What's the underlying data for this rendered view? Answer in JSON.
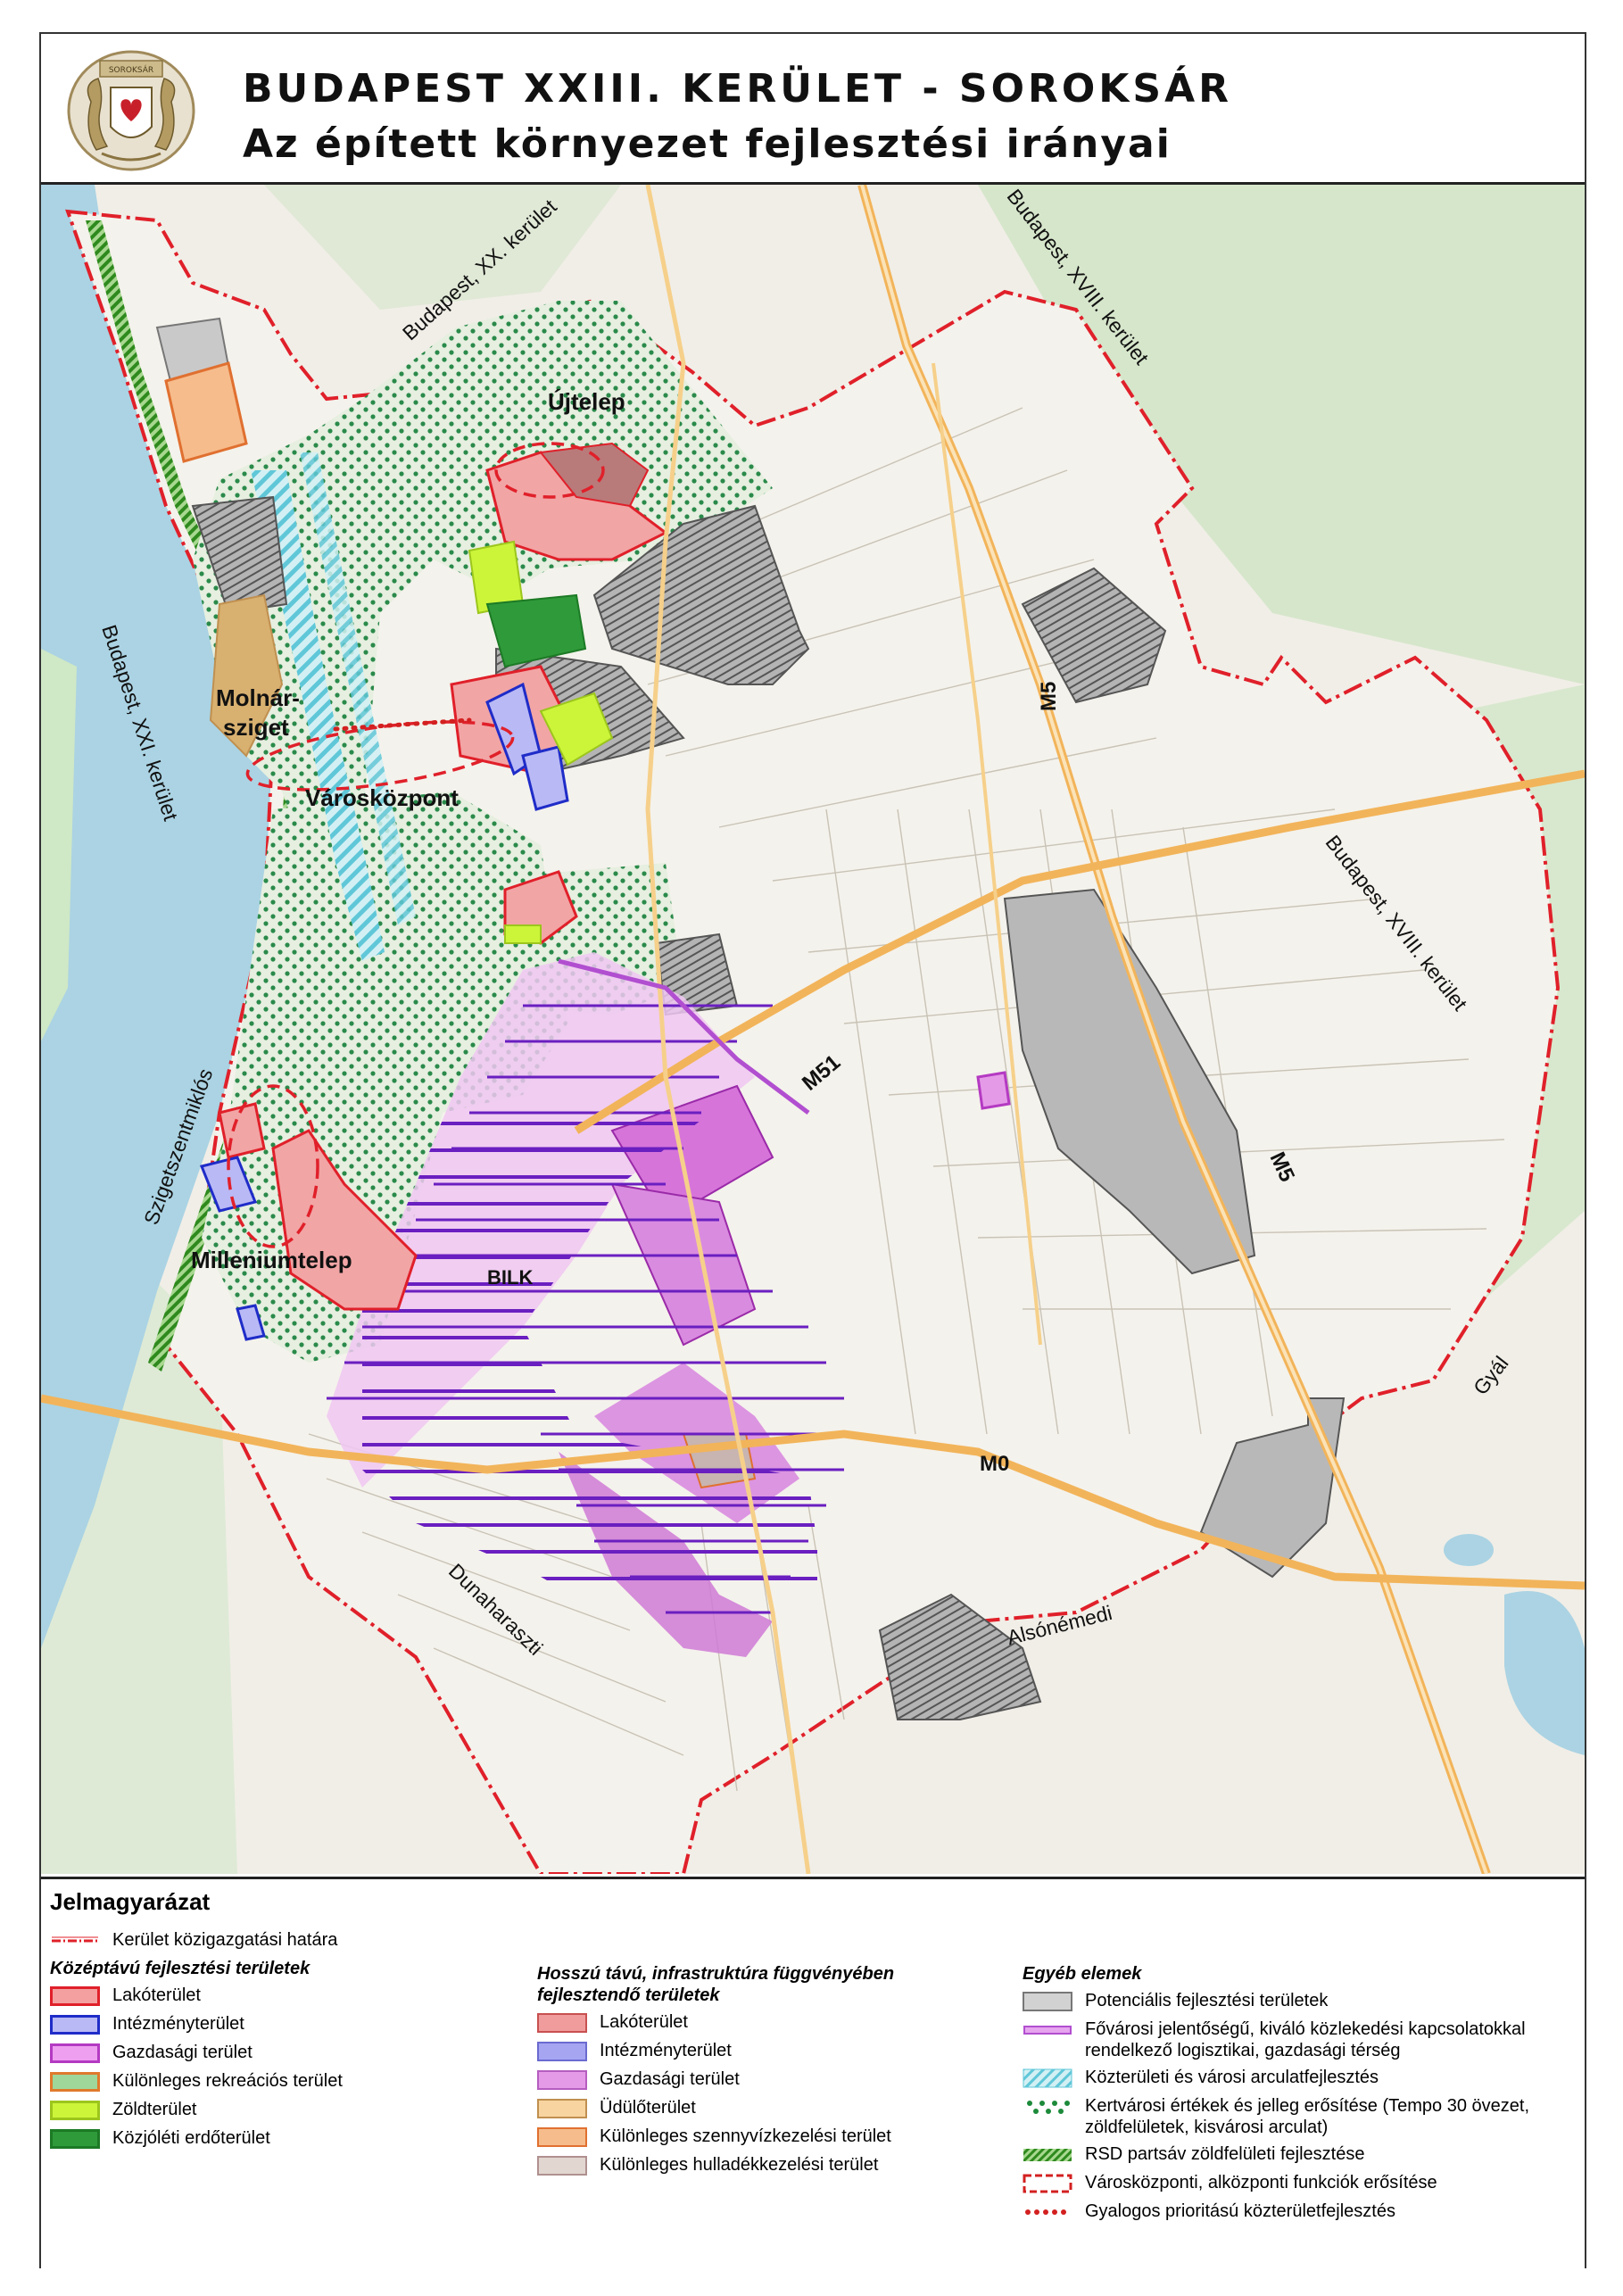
{
  "header": {
    "title_line1": "BUDAPEST XXIII. KERÜLET - SOROKSÁR",
    "title_line2": "Az épített környezet fejlesztési irányai",
    "crest_text": "SOROKSÁR"
  },
  "map": {
    "places": {
      "ujtelep": "Újtelep",
      "molnar1": "Molnár-",
      "molnar2": "sziget",
      "varoskozpont": "Városközpont",
      "milleniumtelep": "Milleniumtelep",
      "bilk": "BILK"
    },
    "neighbors": {
      "xx": "Budapest, XX. kerület",
      "xviii_top": "Budapest, XVIII. kerület",
      "xviii_right": "Budapest, XVIII. kerület",
      "xxi": "Budapest, XXI. kerület",
      "szigetszentmiklos": "Szigetszentmiklós",
      "dunaharaszti": "Dunaharaszti",
      "alsonemedi": "Alsónémedi",
      "gyal": "Gyál"
    },
    "roads": {
      "m5_top": "M5",
      "m5_bottom": "M5",
      "m51": "M51",
      "m0": "M0"
    }
  },
  "legend": {
    "title": "Jelmagyarázat",
    "boundary_label": "Kerület közigazgatási határa",
    "col1": {
      "heading": "Középtávú fejlesztési területek",
      "items": [
        {
          "label": "Lakóterület",
          "fill": "#f4a0a0",
          "border": "#e0202a"
        },
        {
          "label": "Intézményterület",
          "fill": "#b9b9f5",
          "border": "#1f2cc8"
        },
        {
          "label": "Gazdasági terület",
          "fill": "#ee9ff0",
          "border": "#b43ac2"
        },
        {
          "label": "Különleges rekreációs terület",
          "fill": "#9fd79a",
          "border": "#e07a2c"
        },
        {
          "label": "Zöldterület",
          "fill": "#ccf53a",
          "border": "#9cc61c"
        },
        {
          "label": "Közjóléti erdőterület",
          "fill": "#2f9a3a",
          "border": "#1c7a25"
        }
      ]
    },
    "col2": {
      "heading": "Hosszú távú, infrastruktúra függvényében fejlesztendő területek",
      "items": [
        {
          "label": "Lakóterület",
          "fill": "#f09c9c",
          "border": "#c85050"
        },
        {
          "label": "Intézményterület",
          "fill": "#a5a5f2",
          "border": "#6a6ad0"
        },
        {
          "label": "Gazdasági terület",
          "fill": "#e59ae8",
          "border": "#b55ec0"
        },
        {
          "label": "Üdülőterület",
          "fill": "#f8d4a0",
          "border": "#c09050"
        },
        {
          "label": "Különleges szennyvízkezelési terület",
          "fill": "#f6bc8c",
          "border": "#e07030"
        },
        {
          "label": "Különleges hulladékkezelési terület",
          "fill": "#e2d6d0",
          "border": "#b09090"
        }
      ]
    },
    "col3": {
      "heading": "Egyéb elemek",
      "items": [
        {
          "label": "Potenciális fejlesztési területek"
        },
        {
          "label": "Fővárosi jelentőségű, kiváló közlekedési kapcsolatokkal rendelkező logisztikai, gazdasági térség"
        },
        {
          "label": "Közterületi és városi arculatfejlesztés"
        },
        {
          "label": "Kertvárosi értékek és jelleg erősítése (Tempo 30 övezet, zöldfelületek, kisvárosi arculat)"
        },
        {
          "label": "RSD partsáv zöldfelületi fejlesztése"
        },
        {
          "label": "Városközponti, alközponti funkciók erősítése"
        },
        {
          "label": "Gyalogos prioritású közterületfejlesztés"
        }
      ]
    },
    "colors": {
      "boundary": "#e0202a",
      "potential": "#9a9a9a",
      "logistics_line": "#b14fd0",
      "cyan_hatch": "#5fc7d8",
      "green_dots": "#1c8a3a",
      "rsd_stripe": "#2f8a1e",
      "red_dots": "#d32020"
    }
  }
}
